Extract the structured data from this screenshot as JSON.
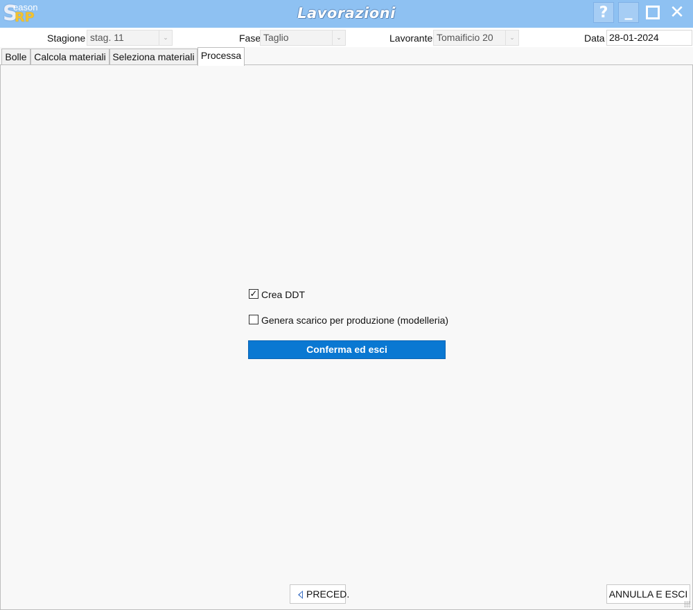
{
  "app": {
    "logo_s": "S",
    "logo_eason": "eason",
    "logo_rp": "RP",
    "title": "Lavorazioni"
  },
  "window_controls": {
    "help": "?",
    "minimize": "_",
    "close": "✕"
  },
  "filters": {
    "stagione": {
      "label": "Stagione",
      "value": "stag. 11"
    },
    "fase": {
      "label": "Fase",
      "value": "Taglio"
    },
    "lavorante": {
      "label": "Lavorante",
      "value": "Tomaificio 20"
    },
    "data": {
      "label": "Data",
      "value": "28-01-2024"
    }
  },
  "tabs": [
    {
      "label": "Bolle",
      "active": false
    },
    {
      "label": "Calcola materiali",
      "active": false
    },
    {
      "label": "Seleziona materiali",
      "active": false
    },
    {
      "label": "Processa",
      "active": true
    }
  ],
  "options": {
    "crea_ddt": {
      "label": "Crea DDT",
      "checked": true
    },
    "genera_scarico": {
      "label": "Genera scarico per produzione (modelleria)",
      "checked": false
    }
  },
  "buttons": {
    "confirm": "Conferma ed esci",
    "prev": "PRECED.",
    "cancel": "ANNULLA E ESCI"
  },
  "colors": {
    "titlebar": "#8ec1f2",
    "accent": "#0a78d2",
    "logo_gold": "#f2c230"
  }
}
